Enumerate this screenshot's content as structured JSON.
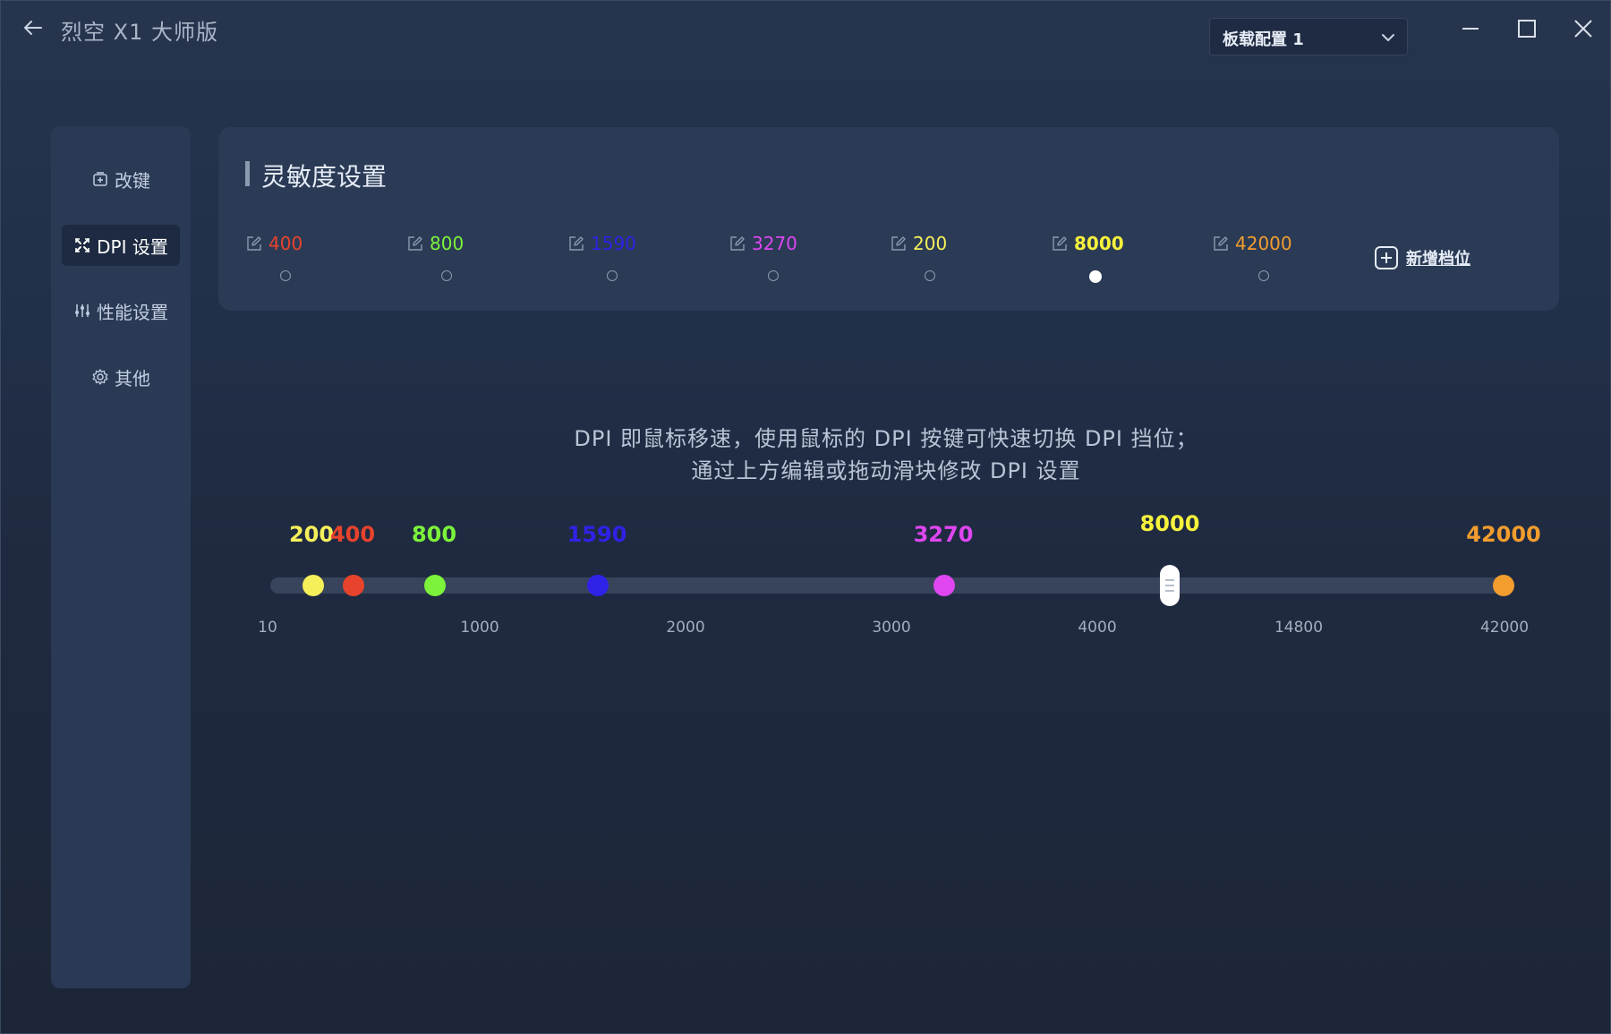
{
  "app": {
    "title": "烈空 X1 大师版",
    "profile_select": "板载配置 1"
  },
  "sidebar": {
    "items": [
      {
        "label": "改键",
        "icon": "keymap-icon",
        "active": false
      },
      {
        "label": "DPI 设置",
        "icon": "dpi-icon",
        "active": true
      },
      {
        "label": "性能设置",
        "icon": "sliders-icon",
        "active": false
      },
      {
        "label": "其他",
        "icon": "gear-icon",
        "active": false
      }
    ]
  },
  "dpi_panel": {
    "title": "灵敏度设置",
    "stages": [
      {
        "value": "400",
        "color": "#e8432c",
        "selected": false
      },
      {
        "value": "800",
        "color": "#7cf23a",
        "selected": false
      },
      {
        "value": "1590",
        "color": "#2f22e6",
        "selected": false
      },
      {
        "value": "3270",
        "color": "#df46f0",
        "selected": false
      },
      {
        "value": "200",
        "color": "#f5f05a",
        "selected": false
      },
      {
        "value": "8000",
        "color": "#f7f23c",
        "selected": true
      },
      {
        "value": "42000",
        "color": "#f29d2e",
        "selected": false
      }
    ],
    "add_stage_label": "新增档位"
  },
  "description": {
    "line1": "DPI 即鼠标移速，使用鼠标的 DPI 按键可快速切换 DPI 挡位；",
    "line2": "通过上方编辑或拖动滑块修改 DPI 设置"
  },
  "slider": {
    "ticks": [
      "10",
      "1000",
      "2000",
      "3000",
      "4000",
      "14800",
      "42000"
    ],
    "markers": [
      {
        "label": "200",
        "value": 200,
        "color": "#f5f05a"
      },
      {
        "label": "400",
        "value": 400,
        "color": "#e8432c"
      },
      {
        "label": "800",
        "value": 800,
        "color": "#7cf23a"
      },
      {
        "label": "1590",
        "value": 1590,
        "color": "#2f22e6"
      },
      {
        "label": "3270",
        "value": 3270,
        "color": "#df46f0"
      },
      {
        "label": "8000",
        "value": 8000,
        "color": "#f7f23c",
        "current": true
      },
      {
        "label": "42000",
        "value": 42000,
        "color": "#f29d2e"
      }
    ]
  }
}
